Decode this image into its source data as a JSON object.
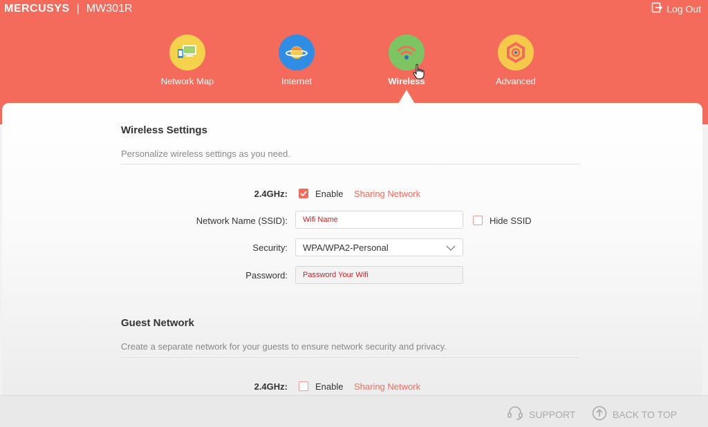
{
  "header": {
    "brand": "MERCUSYS",
    "separator": "|",
    "model": "MW301R",
    "logout_label": "Log Out"
  },
  "nav": {
    "items": [
      {
        "label": "Network Map",
        "icon": "network-map-icon",
        "color": "#f5d24c"
      },
      {
        "label": "Internet",
        "icon": "globe-icon",
        "color": "#2f8de4"
      },
      {
        "label": "Wireless",
        "icon": "wifi-icon",
        "color": "#7dc463",
        "active": true
      },
      {
        "label": "Advanced",
        "icon": "gear-icon",
        "color": "#f5c94a"
      }
    ]
  },
  "wireless": {
    "title": "Wireless Settings",
    "description": "Personalize wireless settings as you need.",
    "band_label": "2.4GHz:",
    "enable_label": "Enable",
    "enable_checked": true,
    "sharing_label": "Sharing Network",
    "ssid_label": "Network Name (SSID):",
    "ssid_value": "Wifi Name",
    "hide_ssid_label": "Hide SSID",
    "hide_ssid_checked": false,
    "security_label": "Security:",
    "security_value": "WPA/WPA2-Personal",
    "password_label": "Password:",
    "password_value": "Password Your Wifi"
  },
  "guest": {
    "title": "Guest Network",
    "description": "Create a separate network for your guests to ensure network security and privacy.",
    "band_label": "2.4GHz:",
    "enable_label": "Enable",
    "enable_checked": false,
    "sharing_label": "Sharing Network"
  },
  "footer": {
    "support_label": "SUPPORT",
    "back_to_top_label": "BACK TO TOP"
  },
  "colors": {
    "accent": "#f46b5c",
    "input_text": "#d01e1e"
  }
}
